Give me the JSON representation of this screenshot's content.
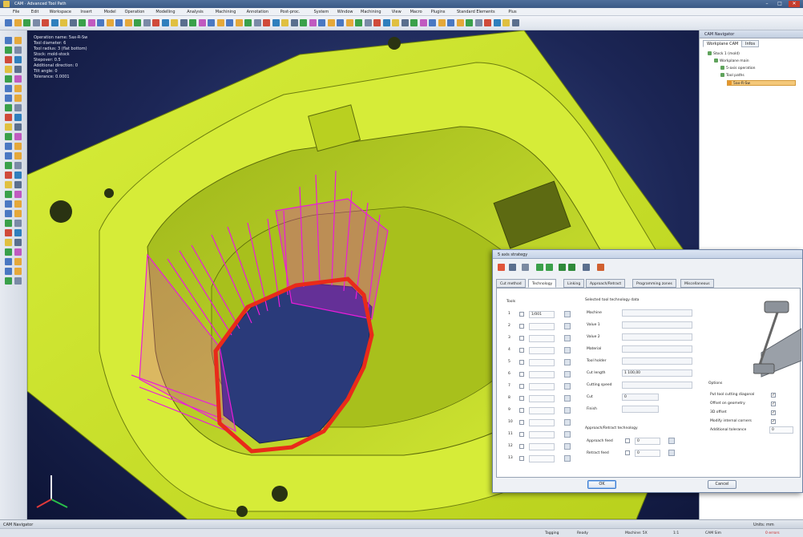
{
  "window": {
    "title": "CAM · Advanced Tool Path"
  },
  "menu": [
    "File",
    "Edit",
    "Workspace",
    "Insert",
    "Model",
    "Operation",
    "Modelling",
    "Analysis",
    "Machining",
    "Annotation",
    "Post-proc.",
    "System",
    "Window",
    "Machining",
    "View",
    "Macro",
    "Plugins",
    "Standard Elements",
    "Plus"
  ],
  "viewport_info": [
    "Operation name: 5ax-R-Sw",
    "Tool diameter: 6",
    "Tool radius: 3 (flat bottom)",
    "Stock: mold-stock",
    "Stepover: 0.5",
    "Additional direction: 0",
    "Tilt angle: 0",
    "Tolerance: 0.0001"
  ],
  "navigator": {
    "header": "CAM Navigator",
    "tabs": [
      "Workplane CAM",
      "Infos"
    ],
    "tree": [
      "Stock 1 (mold)",
      "Workplane main",
      "5-axis operation",
      "Tool paths",
      "5ax-R-Sw"
    ]
  },
  "dialog": {
    "title": "5 axis strategy",
    "tabs": [
      "Cut method",
      "Technology",
      "Linking",
      "Approach/Retract",
      "Programming zones",
      "Miscellaneous"
    ],
    "active_tab": 1,
    "tools_header": "Tools",
    "rows": [
      "1",
      "2",
      "3",
      "4",
      "5",
      "6",
      "7",
      "8",
      "9",
      "10",
      "11",
      "12",
      "13"
    ],
    "row1_value": "1/001",
    "tech_header": "Selected tool technology data",
    "fields": [
      {
        "label": "Machine",
        "value": ""
      },
      {
        "label": "Value 1",
        "value": ""
      },
      {
        "label": "Value 2",
        "value": ""
      },
      {
        "label": "Material",
        "value": ""
      },
      {
        "label": "Tool holder",
        "value": ""
      },
      {
        "label": "Cut length",
        "value": "1 100,00"
      },
      {
        "label": "Cutting speed",
        "value": ""
      },
      {
        "label": "Cut",
        "value": "0"
      },
      {
        "label": "Finish",
        "value": ""
      }
    ],
    "approach_header": "Approach/Retract technology",
    "approach_rows": [
      {
        "label": "Approach feed",
        "value": "0"
      },
      {
        "label": "Retract feed",
        "value": "0"
      }
    ],
    "options_header": "Options",
    "options": [
      {
        "label": "Put tool cutting diagonal",
        "checked": true
      },
      {
        "label": "Offset on geometry",
        "checked": true
      },
      {
        "label": "3D offset",
        "checked": true
      },
      {
        "label": "Modify internal corners",
        "checked": true
      },
      {
        "label": "Additional tolerance",
        "value": "0"
      }
    ],
    "ok_label": "OK",
    "cancel_label": "Cancel"
  },
  "statusbar": {
    "left": "CAM Navigator",
    "right": "Units: mm"
  },
  "taskbar": {
    "left": "Tagging",
    "items": [
      "Ready",
      "Machine: 5X",
      "1:1",
      "CAM Sim"
    ],
    "alert": "0 errors"
  },
  "colors": {
    "part": "#c8e02a",
    "part_dark": "#8da012",
    "toolpath_magenta": "#ea1cda",
    "toolpath_red": "#e92a1a",
    "background": "#1c2656"
  }
}
